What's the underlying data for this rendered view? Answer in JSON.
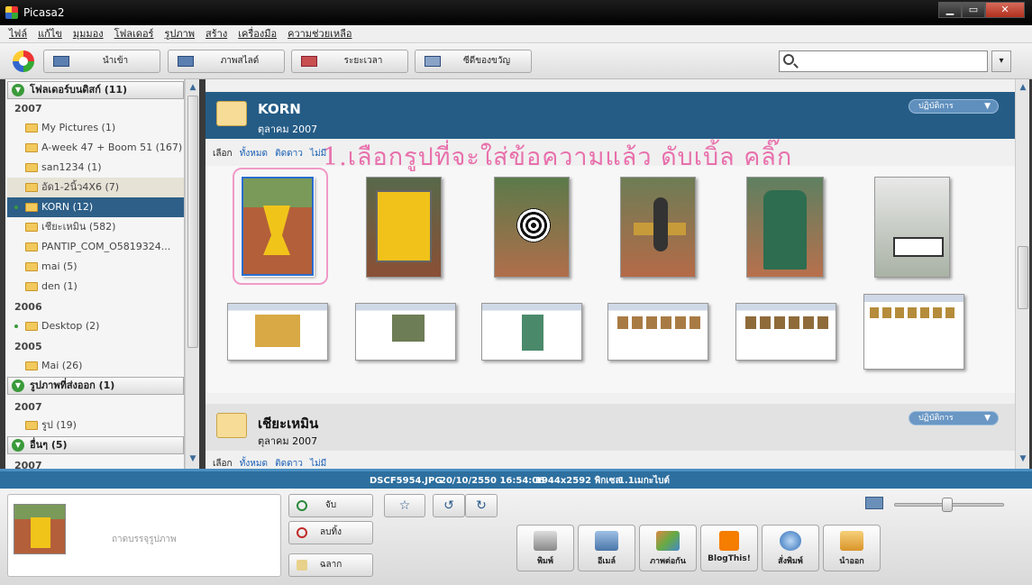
{
  "window": {
    "title": "Picasa2",
    "controls": [
      "▁",
      "▭",
      "✕"
    ]
  },
  "menu": [
    "ไฟล์",
    "แก้ไข",
    "มุมมอง",
    "โฟลเดอร์",
    "รูปภาพ",
    "สร้าง",
    "เครื่องมือ",
    "ความช่วยเหลือ"
  ],
  "toolbar": {
    "import": "นำเข้า",
    "slideshow": "ภาพสไลด์",
    "timeline": "ระยะเวลา",
    "gift_cd": "ซีดีของขวัญ",
    "search_placeholder": ""
  },
  "sidebar": {
    "sections": [
      {
        "label": "โฟลเดอร์บนดิสก์ (11)"
      },
      {
        "label": "รูปภาพที่ส่งออก (1)"
      },
      {
        "label": "อื่นๆ (5)"
      }
    ],
    "years": [
      "2007",
      "2006",
      "2005",
      "2007",
      "2007"
    ],
    "folders": [
      "My Pictures (1)",
      "A-week 47 + Boom 51 (167)",
      "san1234 (1)",
      "อัด1-2นิ้ว4X6 (7)",
      "KORN (12)",
      "เชียะเหมิน (582)",
      "PANTIP_COM_O5819324...",
      "mai (5)",
      "den (1)",
      "Desktop (2)",
      "Mai (26)",
      "รูป (19)"
    ]
  },
  "albums": [
    {
      "name": "KORN",
      "date": "ตุลาคม 2007",
      "actions": "ปฏิบัติการ"
    },
    {
      "name": "เชียะเหมิน",
      "date": "ตุลาคม 2007",
      "actions": "ปฏิบัติการ"
    }
  ],
  "selection_bar": {
    "label": "เลือก",
    "all": "ทั้งหมด",
    "starred": "ติดดาว",
    "none": "ไม่มี"
  },
  "annotation": "1.เลือกรูปที่จะใส่ข้อความแล้ว ดับเบิ้ล คลิ๊ก",
  "photos": [
    {
      "scene": "street-yellow-sculpture"
    },
    {
      "scene": "yellow-sign"
    },
    {
      "scene": "spiral-sculpture"
    },
    {
      "scene": "bench-statue"
    },
    {
      "scene": "green-postbox"
    },
    {
      "scene": "shop-sign"
    },
    {
      "scene": "screenshot-1"
    },
    {
      "scene": "screenshot-2"
    },
    {
      "scene": "screenshot-3"
    },
    {
      "scene": "screenshot-4"
    },
    {
      "scene": "screenshot-5"
    },
    {
      "scene": "screenshot-6"
    }
  ],
  "status": {
    "filename": "DSCF5954.JPG",
    "datetime": "20/10/2550 16:54:06",
    "dimensions": "1944x2592 พิกเซล",
    "size": "1.1เมกะไบต์"
  },
  "bottom": {
    "tray_label": "ถาดบรรจุรูปภาพ",
    "hold": "จับ",
    "clear": "ลบทิ้ง",
    "label": "ฉลาก",
    "actions": [
      "พิมพ์",
      "อีเมล์",
      "ภาพต่อกัน",
      "BlogThis!",
      "สั่งพิมพ์",
      "นำออก"
    ]
  },
  "colors": {
    "accent": "#255c86",
    "status": "#2d6f9f",
    "annotation": "#e870ac",
    "selected": "#2d5f88"
  }
}
